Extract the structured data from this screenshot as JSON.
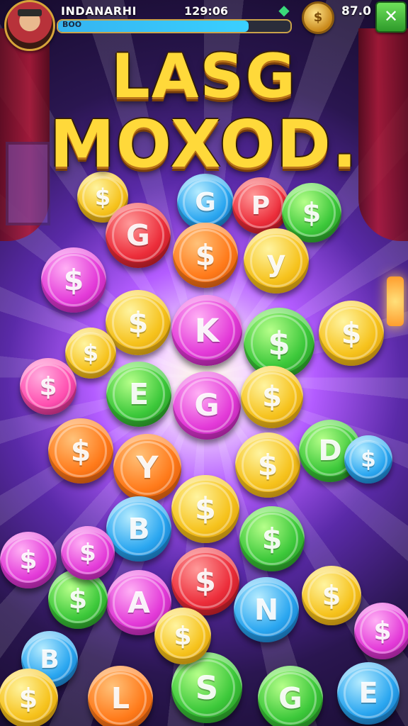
{
  "hud": {
    "player_name": "INDANARHI",
    "xp_label": "BOO",
    "xp_progress": 0.82,
    "clock": "129:06",
    "gem_icon": "gem-icon",
    "coin_icon_glyph": "$",
    "coin_count": "87.0",
    "close_label": "✕"
  },
  "title": {
    "line1": "LASG",
    "line2": "MOXOD."
  },
  "colors": {
    "background": "#2a1650",
    "title_yellow": "#ffd93a",
    "close_green": "#2e9a2a",
    "xp_blue": "#35b4f0"
  },
  "coins": [
    {
      "symbol": "G",
      "color": "blue"
    },
    {
      "symbol": "P",
      "color": "red"
    },
    {
      "symbol": "$",
      "color": "green"
    },
    {
      "symbol": "$",
      "color": "yellow"
    },
    {
      "symbol": "G",
      "color": "red"
    },
    {
      "symbol": "$",
      "color": "orange"
    },
    {
      "symbol": "y",
      "color": "yellow"
    },
    {
      "symbol": "$",
      "color": "pink"
    },
    {
      "symbol": "$",
      "color": "yellow"
    },
    {
      "symbol": "K",
      "color": "pink"
    },
    {
      "symbol": "$",
      "color": "green"
    },
    {
      "symbol": "$",
      "color": "yellow"
    },
    {
      "symbol": "$",
      "color": "yellow"
    },
    {
      "symbol": "$",
      "color": "magenta"
    },
    {
      "symbol": "E",
      "color": "green"
    },
    {
      "symbol": "G",
      "color": "pink"
    },
    {
      "symbol": "$",
      "color": "yellow"
    },
    {
      "symbol": "$",
      "color": "orange"
    },
    {
      "symbol": "Y",
      "color": "orange"
    },
    {
      "symbol": "$",
      "color": "yellow"
    },
    {
      "symbol": "D",
      "color": "green"
    },
    {
      "symbol": "$",
      "color": "blue"
    },
    {
      "symbol": "B",
      "color": "blue"
    },
    {
      "symbol": "$",
      "color": "yellow"
    },
    {
      "symbol": "$",
      "color": "green"
    },
    {
      "symbol": "$",
      "color": "pink"
    },
    {
      "symbol": "$",
      "color": "red"
    },
    {
      "symbol": "A",
      "color": "pink"
    },
    {
      "symbol": "$",
      "color": "green"
    },
    {
      "symbol": "N",
      "color": "blue"
    },
    {
      "symbol": "$",
      "color": "yellow"
    },
    {
      "symbol": "$",
      "color": "pink"
    },
    {
      "symbol": "B",
      "color": "blue"
    },
    {
      "symbol": "$",
      "color": "yellow"
    },
    {
      "symbol": "L",
      "color": "orange"
    },
    {
      "symbol": "S",
      "color": "green"
    },
    {
      "symbol": "G",
      "color": "green"
    },
    {
      "symbol": "E",
      "color": "blue"
    },
    {
      "symbol": "$",
      "color": "yellow"
    },
    {
      "symbol": "$",
      "color": "pink"
    }
  ]
}
